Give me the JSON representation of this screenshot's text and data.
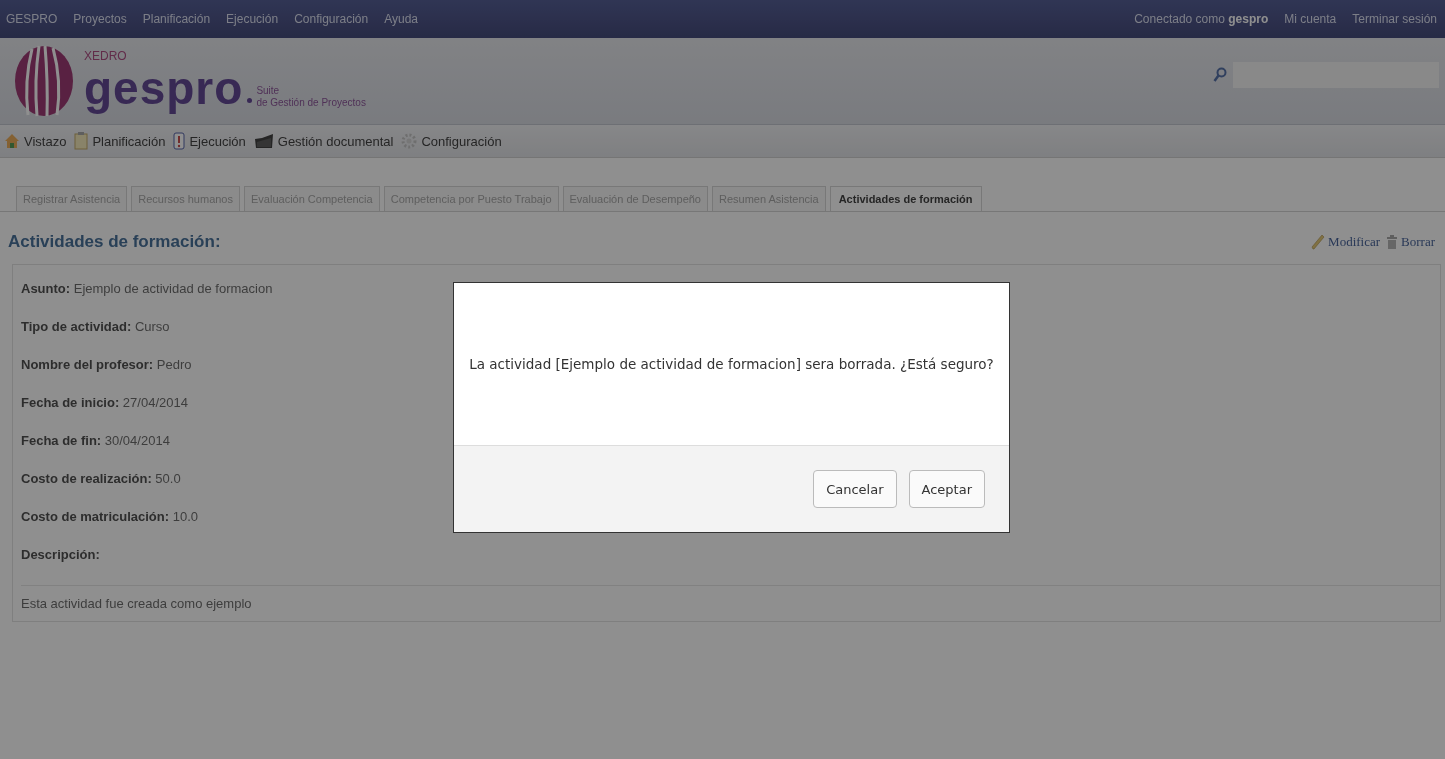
{
  "top_menu": [
    "GESPRO",
    "Proyectos",
    "Planificación",
    "Ejecución",
    "Configuración",
    "Ayuda"
  ],
  "user": {
    "prefix": "Conectado como",
    "username": "gespro"
  },
  "account_links": [
    "Mi cuenta",
    "Terminar sesión"
  ],
  "logo": {
    "brand": "XEDRO",
    "name": "gespro",
    "tagline_1": "Suite",
    "tagline_2": "de Gestión de Proyectos"
  },
  "nav": [
    {
      "label": "Vistazo",
      "kind": "home"
    },
    {
      "label": "Planificación",
      "kind": "clipboard"
    },
    {
      "label": "Ejecución",
      "kind": "alert"
    },
    {
      "label": "Gestión documental",
      "kind": "folder"
    },
    {
      "label": "Configuración",
      "kind": "gear"
    }
  ],
  "tabs": [
    {
      "label": "Registrar Asistencia",
      "selected": false
    },
    {
      "label": "Recursos humanos",
      "selected": false
    },
    {
      "label": "Evaluación Competencia",
      "selected": false
    },
    {
      "label": "Competencia por Puesto Trabajo",
      "selected": false
    },
    {
      "label": "Evaluación de Desempeño",
      "selected": false
    },
    {
      "label": "Resumen Asistencia",
      "selected": false
    },
    {
      "label": "Actividades de formación",
      "selected": true
    }
  ],
  "section": {
    "title": "Actividades de formación:",
    "actions": [
      {
        "label": "Modificar",
        "kind": "edit"
      },
      {
        "label": "Borrar",
        "kind": "delete"
      }
    ]
  },
  "details": [
    {
      "label": "Asunto:",
      "value": "Ejemplo de actividad de formacion"
    },
    {
      "label": "Tipo de actividad:",
      "value": "Curso"
    },
    {
      "label": "Nombre del profesor:",
      "value": "Pedro"
    },
    {
      "label": "Fecha de inicio:",
      "value": "27/04/2014"
    },
    {
      "label": "Fecha de fin:",
      "value": "30/04/2014"
    },
    {
      "label": "Costo de realización:",
      "value": "50.0"
    },
    {
      "label": "Costo de matriculación:",
      "value": "10.0"
    }
  ],
  "description": {
    "label": "Descripción:",
    "text": "Esta actividad fue creada como ejemplo"
  },
  "dialog": {
    "message": "La actividad [Ejemplo de actividad de formacion] sera borrada. ¿Está seguro?",
    "buttons": [
      "Cancelar",
      "Aceptar"
    ]
  }
}
